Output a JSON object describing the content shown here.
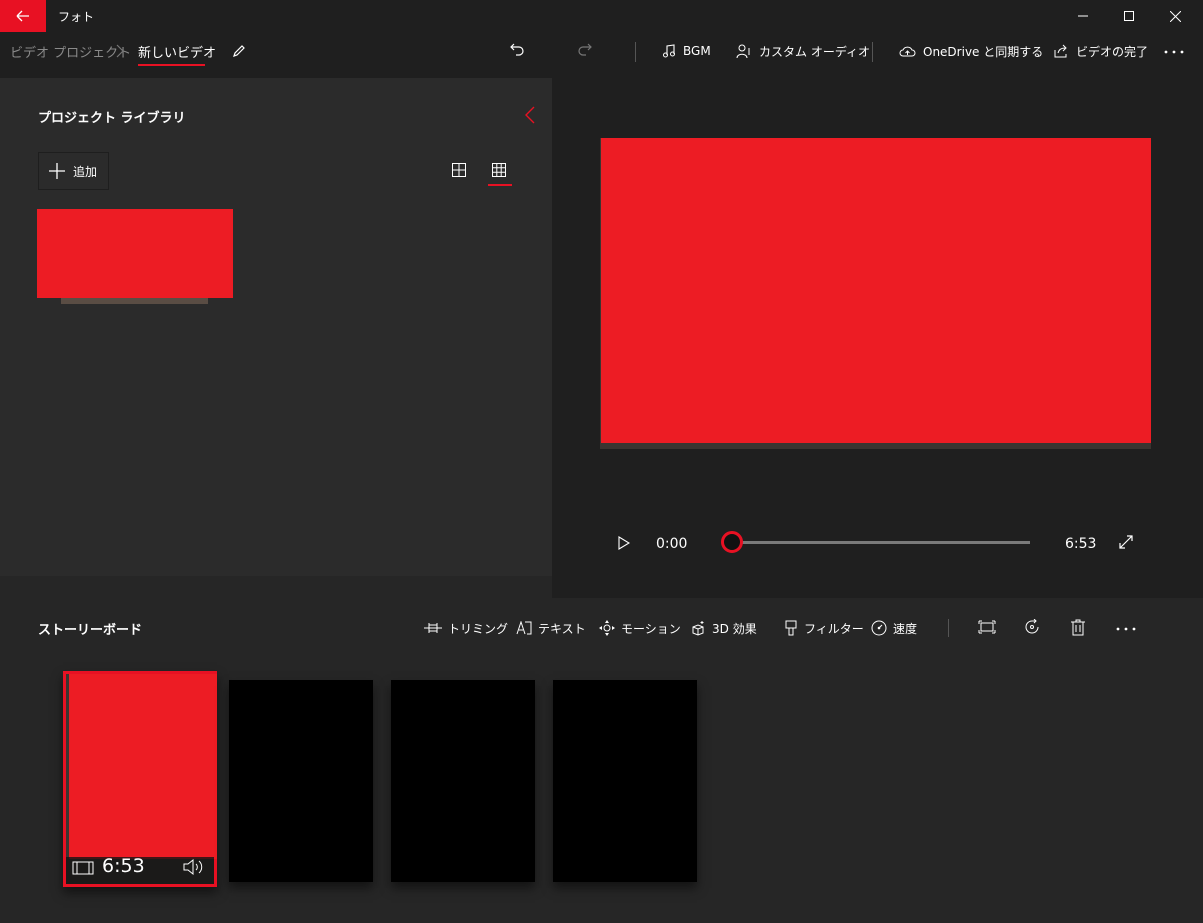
{
  "window": {
    "app_title": "フォト"
  },
  "breadcrumb": {
    "parent": "ビデオ プロジェクト",
    "current": "新しいビデオ"
  },
  "toolbar": {
    "bgm": "BGM",
    "custom_audio": "カスタム オーディオ",
    "onedrive_sync": "OneDrive と同期する",
    "finish_video": "ビデオの完了"
  },
  "library": {
    "title": "プロジェクト ライブラリ",
    "add_label": "追加"
  },
  "player": {
    "current_time": "0:00",
    "total_time": "6:53",
    "progress": 0
  },
  "storyboard": {
    "title": "ストーリーボード",
    "tools": {
      "trim": "トリミング",
      "text": "テキスト",
      "motion": "モーション",
      "effects_3d": "3D 効果",
      "filters": "フィルター",
      "speed": "速度"
    },
    "clips": [
      {
        "duration": "6:53",
        "selected": true
      },
      {
        "duration": "",
        "selected": false
      },
      {
        "duration": "",
        "selected": false
      },
      {
        "duration": "",
        "selected": false
      }
    ]
  },
  "colors": {
    "accent": "#e81123",
    "redaction": "#ed1c24",
    "panel": "#2b2b2b",
    "background": "#1f1f1f"
  }
}
